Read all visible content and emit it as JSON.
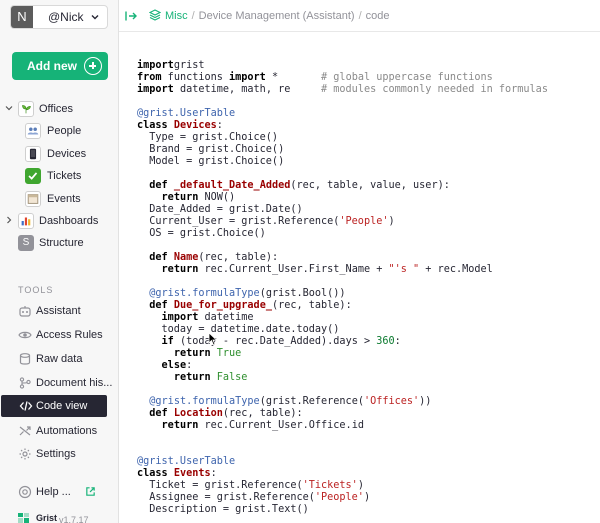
{
  "org": {
    "avatar_letter": "N",
    "name": "@Nick"
  },
  "add_new": "Add new",
  "nav": {
    "doc_name": "Offices",
    "pages": [
      "People",
      "Devices",
      "Tickets",
      "Events"
    ],
    "dashboards": "Dashboards",
    "structure": "Structure",
    "structure_letter": "S"
  },
  "tools": {
    "heading": "TOOLS",
    "items": [
      "Assistant",
      "Access Rules",
      "Raw data",
      "Document his...",
      "Code view",
      "Automations",
      "Settings"
    ],
    "help": "Help ...",
    "active_item": "Code view"
  },
  "footer": {
    "brand": "Grist",
    "version": "v1.7.17"
  },
  "breadcrumb": {
    "workspace": "Misc",
    "document": "Device Management (Assistant)",
    "page": "code"
  },
  "code_lines": [
    [
      [
        "kw",
        "import"
      ],
      [
        "",
        "grist"
      ]
    ],
    [
      [
        "kw",
        "from"
      ],
      [
        "",
        " functions "
      ],
      [
        "kw",
        "import"
      ],
      [
        "",
        " *       "
      ],
      [
        "cmt",
        "# global uppercase functions"
      ]
    ],
    [
      [
        "kw",
        "import"
      ],
      [
        "",
        " datetime, math, re     "
      ],
      [
        "cmt",
        "# modules commonly needed in formulas"
      ]
    ],
    [],
    [
      [
        "dec",
        "@grist.UserTable"
      ]
    ],
    [
      [
        "kw",
        "class"
      ],
      [
        "",
        " "
      ],
      [
        "fn",
        "Devices"
      ],
      [
        "",
        ":"
      ]
    ],
    [
      [
        "",
        "  Type = grist.Choice()"
      ]
    ],
    [
      [
        "",
        "  Brand = grist.Choice()"
      ]
    ],
    [
      [
        "",
        "  Model = grist.Choice()"
      ]
    ],
    [],
    [
      [
        "",
        "  "
      ],
      [
        "kw",
        "def"
      ],
      [
        "",
        " "
      ],
      [
        "fn",
        "_default_Date_Added"
      ],
      [
        "",
        "(rec, table, value, user):"
      ]
    ],
    [
      [
        "",
        "    "
      ],
      [
        "kw",
        "return"
      ],
      [
        "",
        " NOW()"
      ]
    ],
    [
      [
        "",
        "  Date_Added = grist.Date()"
      ]
    ],
    [
      [
        "",
        "  Current_User = grist.Reference("
      ],
      [
        "str",
        "'People'"
      ],
      [
        "",
        ")"
      ]
    ],
    [
      [
        "",
        "  OS = grist.Choice()"
      ]
    ],
    [],
    [
      [
        "",
        "  "
      ],
      [
        "kw",
        "def"
      ],
      [
        "",
        " "
      ],
      [
        "fn",
        "Name"
      ],
      [
        "",
        "(rec, table):"
      ]
    ],
    [
      [
        "",
        "    "
      ],
      [
        "kw",
        "return"
      ],
      [
        "",
        " rec.Current_User.First_Name + "
      ],
      [
        "str",
        "\"'s \""
      ],
      [
        "",
        " + rec.Model"
      ]
    ],
    [],
    [
      [
        "",
        "  "
      ],
      [
        "dec",
        "@grist.formulaType"
      ],
      [
        "",
        "(grist.Bool())"
      ]
    ],
    [
      [
        "",
        "  "
      ],
      [
        "kw",
        "def"
      ],
      [
        "",
        " "
      ],
      [
        "fn",
        "Due_for_upgrade_"
      ],
      [
        "",
        "(rec, table):"
      ]
    ],
    [
      [
        "",
        "    "
      ],
      [
        "kw",
        "import"
      ],
      [
        "",
        " datetime"
      ]
    ],
    [
      [
        "",
        "    today = datetime.date.today()"
      ]
    ],
    [
      [
        "",
        "    "
      ],
      [
        "kw",
        "if"
      ],
      [
        "",
        " (today - rec.Date_Added).days > "
      ],
      [
        "num",
        "360"
      ],
      [
        "",
        ":"
      ]
    ],
    [
      [
        "",
        "      "
      ],
      [
        "kw",
        "return"
      ],
      [
        "",
        " "
      ],
      [
        "bool",
        "True"
      ]
    ],
    [
      [
        "",
        "    "
      ],
      [
        "kw",
        "else"
      ],
      [
        "",
        ":"
      ]
    ],
    [
      [
        "",
        "      "
      ],
      [
        "kw",
        "return"
      ],
      [
        "",
        " "
      ],
      [
        "bool",
        "False"
      ]
    ],
    [],
    [
      [
        "",
        "  "
      ],
      [
        "dec",
        "@grist.formulaType"
      ],
      [
        "",
        "(grist.Reference("
      ],
      [
        "str",
        "'Offices'"
      ],
      [
        "",
        "))"
      ]
    ],
    [
      [
        "",
        "  "
      ],
      [
        "kw",
        "def"
      ],
      [
        "",
        " "
      ],
      [
        "fn",
        "Location"
      ],
      [
        "",
        "(rec, table):"
      ]
    ],
    [
      [
        "",
        "    "
      ],
      [
        "kw",
        "return"
      ],
      [
        "",
        " rec.Current_User.Office.id"
      ]
    ],
    [],
    [],
    [
      [
        "dec",
        "@grist.UserTable"
      ]
    ],
    [
      [
        "kw",
        "class"
      ],
      [
        "",
        " "
      ],
      [
        "fn",
        "Events"
      ],
      [
        "",
        ":"
      ]
    ],
    [
      [
        "",
        "  Ticket = grist.Reference("
      ],
      [
        "str",
        "'Tickets'"
      ],
      [
        "",
        ")"
      ]
    ],
    [
      [
        "",
        "  Assignee = grist.Reference("
      ],
      [
        "str",
        "'People'"
      ],
      [
        "",
        ")"
      ]
    ],
    [
      [
        "",
        "  Description = grist.Text()"
      ]
    ]
  ]
}
